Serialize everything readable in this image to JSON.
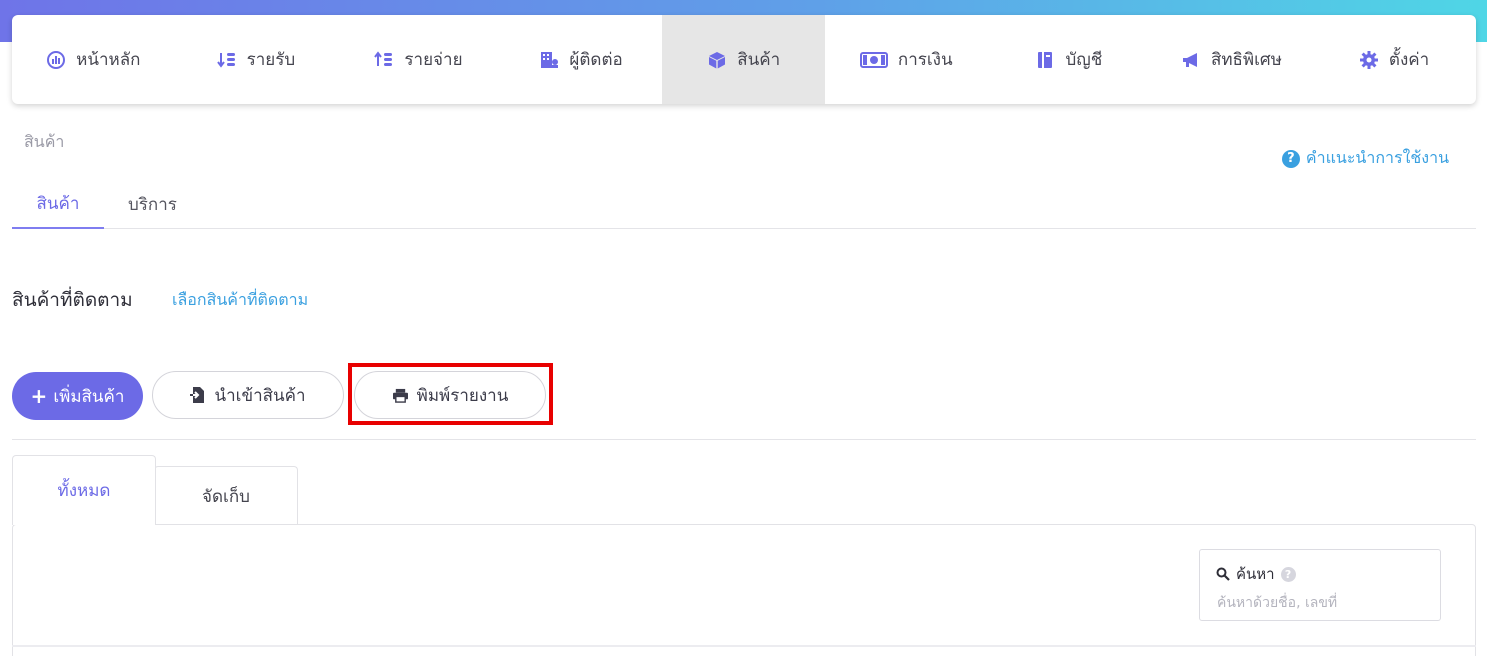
{
  "nav": {
    "items": [
      {
        "label": "หน้าหลัก",
        "icon": "dashboard-icon"
      },
      {
        "label": "รายรับ",
        "icon": "income-icon"
      },
      {
        "label": "รายจ่าย",
        "icon": "expense-icon"
      },
      {
        "label": "ผู้ติดต่อ",
        "icon": "contacts-icon"
      },
      {
        "label": "สินค้า",
        "icon": "box-icon",
        "active": true
      },
      {
        "label": "การเงิน",
        "icon": "money-icon"
      },
      {
        "label": "บัญชี",
        "icon": "ledger-icon"
      },
      {
        "label": "สิทธิพิเศษ",
        "icon": "megaphone-icon"
      },
      {
        "label": "ตั้งค่า",
        "icon": "gear-icon"
      }
    ]
  },
  "breadcrumb": "สินค้า",
  "help_link": "คำแนะนำการใช้งาน",
  "top_tabs": [
    {
      "label": "สินค้า",
      "active": true
    },
    {
      "label": "บริการ"
    }
  ],
  "section": {
    "title": "สินค้าที่ติดตาม",
    "link": "เลือกสินค้าที่ติดตาม"
  },
  "actions": {
    "add_label": "เพิ่มสินค้า",
    "import_label": "นำเข้าสินค้า",
    "print_label": "พิมพ์รายงาน"
  },
  "sub_tabs": [
    {
      "label": "ทั้งหมด",
      "active": true
    },
    {
      "label": "จัดเก็บ"
    }
  ],
  "search": {
    "label": "ค้นหา",
    "placeholder": "ค้นหาด้วยชื่อ, เลขที่"
  },
  "colors": {
    "accent": "#6c6ae6",
    "link": "#3aa0e0",
    "highlight": "#e80000"
  }
}
